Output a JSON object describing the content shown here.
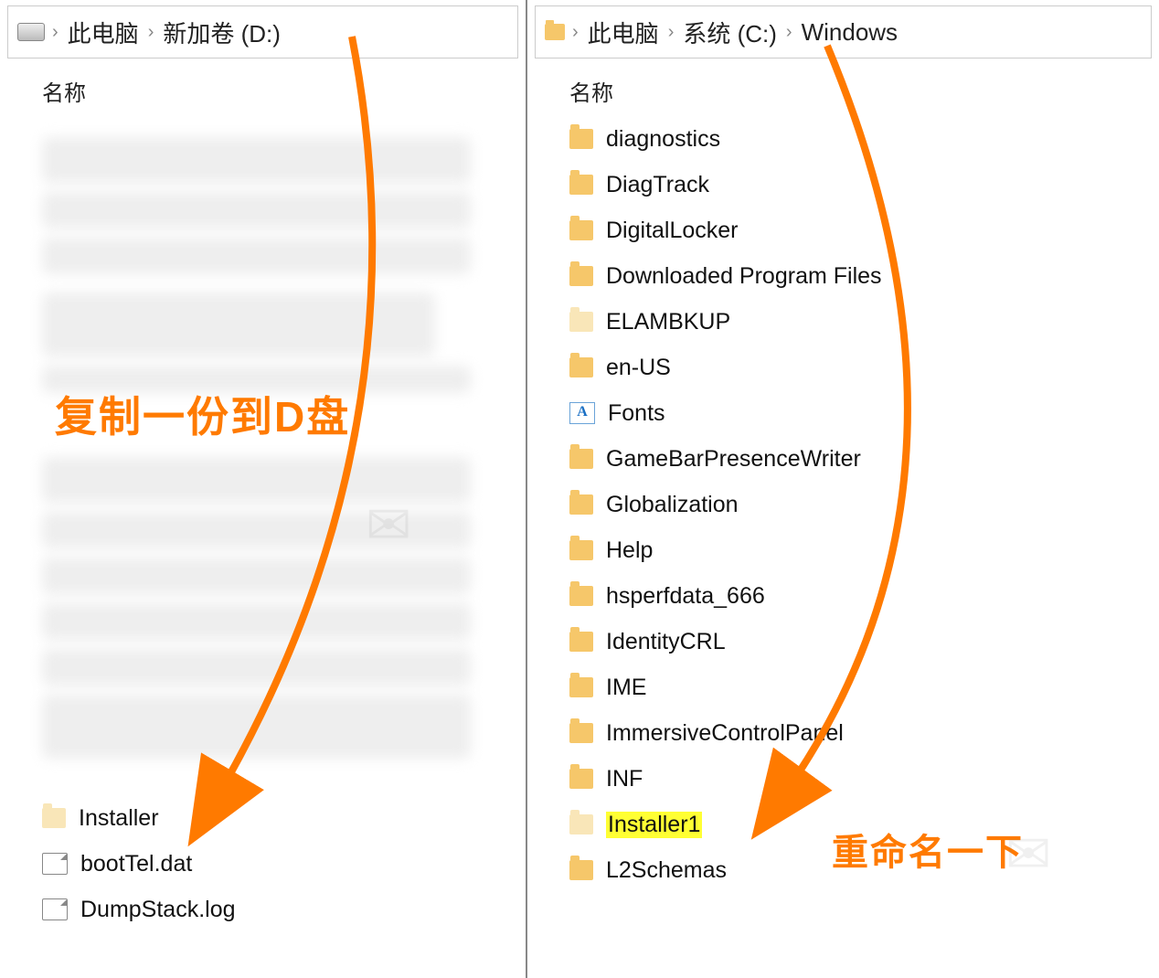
{
  "left": {
    "breadcrumbs": [
      "此电脑",
      "新加卷 (D:)"
    ],
    "column_header": "名称",
    "items": [
      {
        "name": "Installer",
        "icon": "folder-pale"
      },
      {
        "name": "bootTel.dat",
        "icon": "file"
      },
      {
        "name": "DumpStack.log",
        "icon": "file"
      }
    ]
  },
  "right": {
    "breadcrumbs": [
      "此电脑",
      "系统 (C:)",
      "Windows"
    ],
    "column_header": "名称",
    "items": [
      {
        "name": "diagnostics",
        "icon": "folder"
      },
      {
        "name": "DiagTrack",
        "icon": "folder"
      },
      {
        "name": "DigitalLocker",
        "icon": "folder"
      },
      {
        "name": "Downloaded Program Files",
        "icon": "folder"
      },
      {
        "name": "ELAMBKUP",
        "icon": "folder-pale"
      },
      {
        "name": "en-US",
        "icon": "folder"
      },
      {
        "name": "Fonts",
        "icon": "fonts"
      },
      {
        "name": "GameBarPresenceWriter",
        "icon": "folder"
      },
      {
        "name": "Globalization",
        "icon": "folder"
      },
      {
        "name": "Help",
        "icon": "folder"
      },
      {
        "name": "hsperfdata_666",
        "icon": "folder"
      },
      {
        "name": "IdentityCRL",
        "icon": "folder"
      },
      {
        "name": "IME",
        "icon": "folder"
      },
      {
        "name": "ImmersiveControlPanel",
        "icon": "folder"
      },
      {
        "name": "INF",
        "icon": "folder"
      },
      {
        "name": "Installer1",
        "icon": "folder-pale",
        "highlight": true
      },
      {
        "name": "L2Schemas",
        "icon": "folder"
      }
    ]
  },
  "annotations": {
    "left": "复制一份到D盘",
    "right": "重命名一下"
  },
  "colors": {
    "accent": "#ff7a00",
    "highlight": "#ffff33"
  }
}
